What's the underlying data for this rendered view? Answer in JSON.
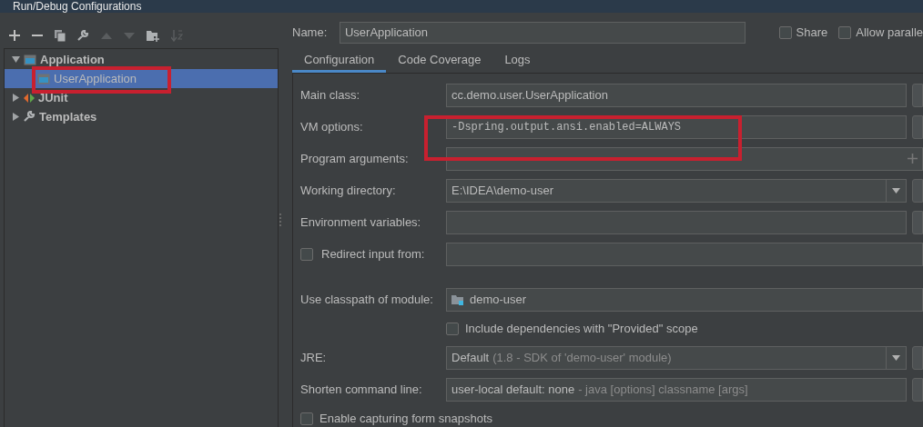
{
  "window": {
    "title": "Run/Debug Configurations"
  },
  "tree": [
    {
      "label": "Application",
      "kind": "app",
      "expanded": true,
      "selected": false,
      "children": [
        {
          "label": "UserApplication",
          "kind": "app",
          "selected": true
        }
      ]
    },
    {
      "label": "JUnit",
      "kind": "junit",
      "expanded": false,
      "selected": false
    },
    {
      "label": "Templates",
      "kind": "wrench",
      "expanded": false,
      "selected": false
    }
  ],
  "name": {
    "label": "Name:",
    "value": "UserApplication"
  },
  "options": [
    {
      "label": "Share",
      "checked": false
    },
    {
      "label": "Allow paralle",
      "checked": false
    }
  ],
  "tabs": [
    {
      "label": "Configuration",
      "selected": true
    },
    {
      "label": "Code Coverage",
      "selected": false
    },
    {
      "label": "Logs",
      "selected": false
    }
  ],
  "rows": [
    {
      "kind": "browse",
      "label": "Main class:",
      "value": "cc.demo.user.UserApplication"
    },
    {
      "kind": "mono",
      "label": "VM options:",
      "value": "-Dspring.output.ansi.enabled=ALWAYS"
    },
    {
      "kind": "add",
      "label": "Program arguments:"
    },
    {
      "kind": "dropdown",
      "label": "Working directory:",
      "value": "E:\\IDEA\\demo-user"
    },
    {
      "kind": "browse",
      "label": "Environment variables:"
    },
    {
      "kind": "checkfield",
      "label": "Redirect input from:",
      "checked": false
    },
    {
      "kind": "gap"
    },
    {
      "kind": "module",
      "label": "Use classpath of module:",
      "value": "demo-user"
    },
    {
      "kind": "check",
      "label": "Include dependencies with \"Provided\" scope",
      "checked": false
    },
    {
      "kind": "dropdown",
      "label": "JRE:",
      "value": "Default",
      "detail": "(1.8 - SDK of 'demo-user' module)"
    },
    {
      "kind": "browse",
      "label": "Shorten command line:",
      "value": "user-local default: none",
      "detail": "- java [options] classname [args]"
    },
    {
      "kind": "bottomcheck",
      "label": "Enable capturing form snapshots",
      "checked": false
    }
  ]
}
